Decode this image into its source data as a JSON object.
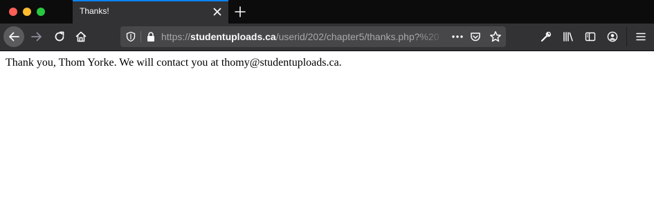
{
  "browser": {
    "tab": {
      "title": "Thanks!"
    },
    "url": {
      "scheme": "https://",
      "host": "studentuploads.ca",
      "path": "/userid/202/chapter5/thanks.php?%20"
    }
  },
  "page": {
    "message": "Thank you, Thom Yorke. We will contact you at thomy@studentuploads.ca."
  },
  "colors": {
    "tab_accent": "#0a84ff",
    "chrome_dark": "#0c0c0d",
    "toolbar": "#323234",
    "urlbar": "#474749"
  },
  "icons": {
    "window_controls": [
      "close-dot",
      "minimize-dot",
      "zoom-dot"
    ],
    "tab": [
      "close-icon",
      "plus-icon"
    ],
    "nav": [
      "back-arrow-icon",
      "forward-arrow-icon",
      "reload-icon",
      "home-icon"
    ],
    "urlbar": [
      "shield-icon",
      "lock-icon",
      "more-dots-icon",
      "pocket-icon",
      "star-icon"
    ],
    "toolbar": [
      "wrench-icon",
      "library-icon",
      "sidebar-icon",
      "account-icon",
      "hamburger-menu-icon"
    ]
  }
}
